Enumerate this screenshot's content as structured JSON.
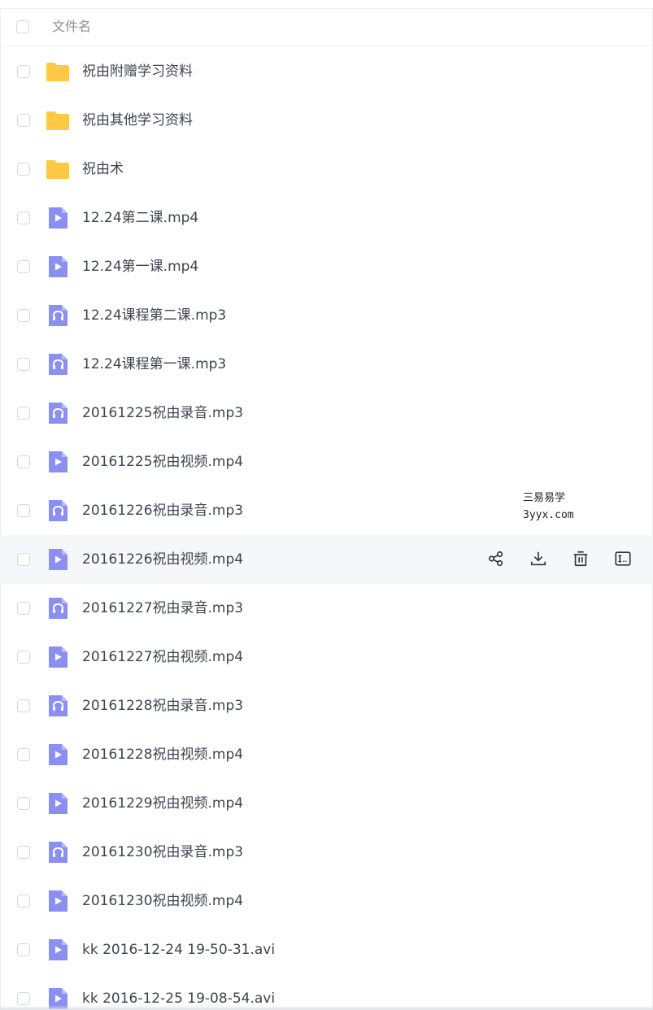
{
  "header": {
    "name_column": "文件名"
  },
  "files": [
    {
      "name": "祝由附赠学习资料",
      "type": "folder"
    },
    {
      "name": "祝由其他学习资料",
      "type": "folder"
    },
    {
      "name": "祝由术",
      "type": "folder"
    },
    {
      "name": "12.24第二课.mp4",
      "type": "video"
    },
    {
      "name": "12.24第一课.mp4",
      "type": "video"
    },
    {
      "name": "12.24课程第二课.mp3",
      "type": "audio"
    },
    {
      "name": "12.24课程第一课.mp3",
      "type": "audio"
    },
    {
      "name": "20161225祝由录音.mp3",
      "type": "audio"
    },
    {
      "name": "20161225祝由视频.mp4",
      "type": "video"
    },
    {
      "name": "20161226祝由录音.mp3",
      "type": "audio"
    },
    {
      "name": "20161226祝由视频.mp4",
      "type": "video",
      "hovered": true
    },
    {
      "name": "20161227祝由录音.mp3",
      "type": "audio"
    },
    {
      "name": "20161227祝由视频.mp4",
      "type": "video"
    },
    {
      "name": "20161228祝由录音.mp3",
      "type": "audio"
    },
    {
      "name": "20161228祝由视频.mp4",
      "type": "video"
    },
    {
      "name": "20161229祝由视频.mp4",
      "type": "video"
    },
    {
      "name": "20161230祝由录音.mp3",
      "type": "audio"
    },
    {
      "name": "20161230祝由视频.mp4",
      "type": "video"
    },
    {
      "name": "kk 2016-12-24 19-50-31.avi",
      "type": "video"
    },
    {
      "name": "kk 2016-12-25 19-08-54.avi",
      "type": "video"
    }
  ],
  "row_actions": [
    {
      "icon": "share-icon"
    },
    {
      "icon": "download-icon"
    },
    {
      "icon": "delete-icon"
    },
    {
      "icon": "rename-icon"
    }
  ],
  "watermark": {
    "line1": "三易易学",
    "line2": "3yyx.com"
  },
  "colors": {
    "folder": "#ffc845",
    "media_icon": "#8b8ff2",
    "hover_row": "#f6f7fa",
    "text": "#3d4450"
  }
}
